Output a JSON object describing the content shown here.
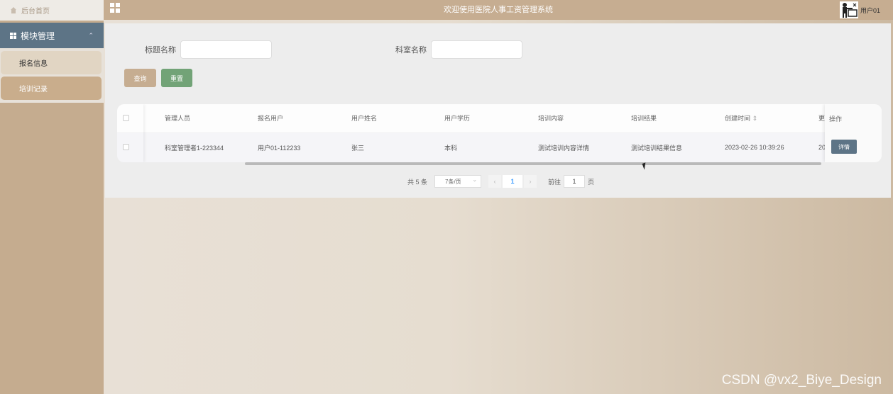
{
  "sidebar": {
    "home_label": "后台首页",
    "module_label": "模块管理",
    "items": [
      {
        "label": "报名信息"
      },
      {
        "label": "培训记录"
      }
    ]
  },
  "header": {
    "title": "欢迎使用医院人事工资管理系统",
    "user": "用户01"
  },
  "search": {
    "fields": [
      {
        "label": "标题名称",
        "value": "",
        "placeholder": ""
      },
      {
        "label": "科室名称",
        "value": "",
        "placeholder": ""
      }
    ],
    "query_label": "查询",
    "reset_label": "重置"
  },
  "table": {
    "columns": [
      "管理人员",
      "报名用户",
      "用户姓名",
      "用户学历",
      "培训内容",
      "培训结果",
      "创建时间",
      "更",
      "操作"
    ],
    "rows": [
      {
        "cells": [
          "科室管理者1-223344",
          "用户01-112233",
          "张三",
          "本科",
          "测试培训内容详情",
          "测试培训结果信息",
          "2023-02-26 10:39:26",
          "20"
        ],
        "action_label": "详情"
      }
    ]
  },
  "pagination": {
    "total_text": "共 5 条",
    "page_size": "7条/页",
    "current_page": "1",
    "goto_label": "前往",
    "goto_value": "1",
    "page_suffix": "页"
  },
  "watermark": "CSDN @vx2_Biye_Design",
  "icons": [
    "home-icon",
    "grid-icon",
    "chevron-up-icon",
    "menu-grid-icon",
    "avatar-icon",
    "sort-icon",
    "chevron-left-icon",
    "chevron-right-icon",
    "mouse-cursor-icon"
  ],
  "colors": {
    "accent": "#c6ad91",
    "module_bg": "#5d7486",
    "reset_btn": "#72a377",
    "pager_active": "#409eff"
  }
}
